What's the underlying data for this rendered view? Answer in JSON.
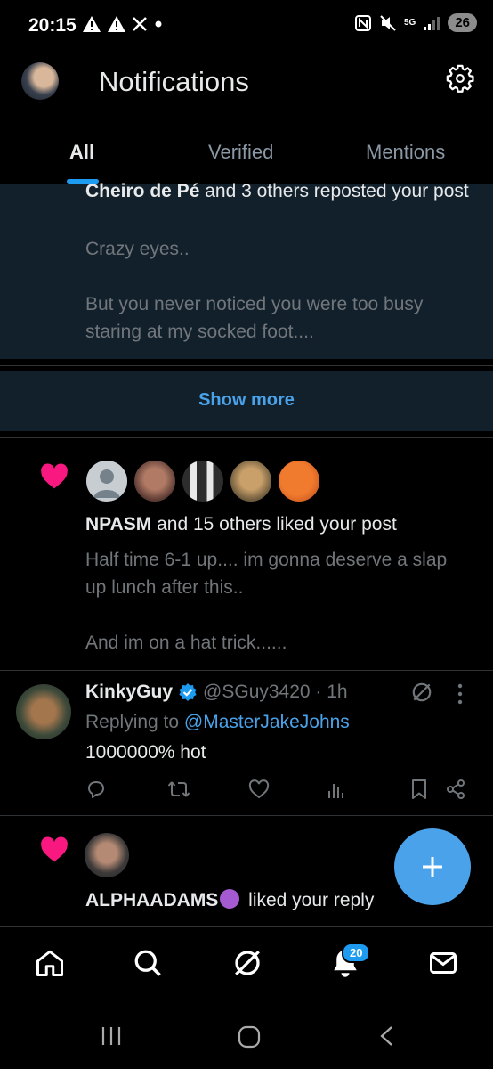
{
  "status_bar": {
    "time": "20:15",
    "network": "5G",
    "battery": "26"
  },
  "header": {
    "title": "Notifications"
  },
  "tabs": [
    {
      "label": "All",
      "active": true
    },
    {
      "label": "Verified",
      "active": false
    },
    {
      "label": "Mentions",
      "active": false
    }
  ],
  "notifications": {
    "repost": {
      "actor": "Cheiro de Pé",
      "action": " and 3 others reposted your post",
      "post_line1": "Crazy eyes..",
      "post_line2": "But you never noticed you were too busy staring at my socked foot...."
    },
    "show_more": "Show more",
    "like": {
      "actor": "NPASM",
      "action": " and 15 others liked your post",
      "post_line1": "Half time 6-1 up.... im gonna deserve a slap up lunch after this..",
      "post_line2": "And im on a hat trick......"
    },
    "reply": {
      "name": "KinkyGuy",
      "handle": "@SGuy3420 · 1h",
      "replying_prefix": "Replying to ",
      "replying_to": "@MasterJakeJohns",
      "body": "1000000% hot"
    },
    "alpha": {
      "actor": "ALPHAADAMS",
      "action": " liked your reply"
    }
  },
  "bottom_nav": {
    "notifications_badge": "20"
  },
  "colors": {
    "accent": "#1d9bf0",
    "link": "#4aa3ea",
    "heart": "#f91880",
    "highlight_bg": "#12202c"
  }
}
